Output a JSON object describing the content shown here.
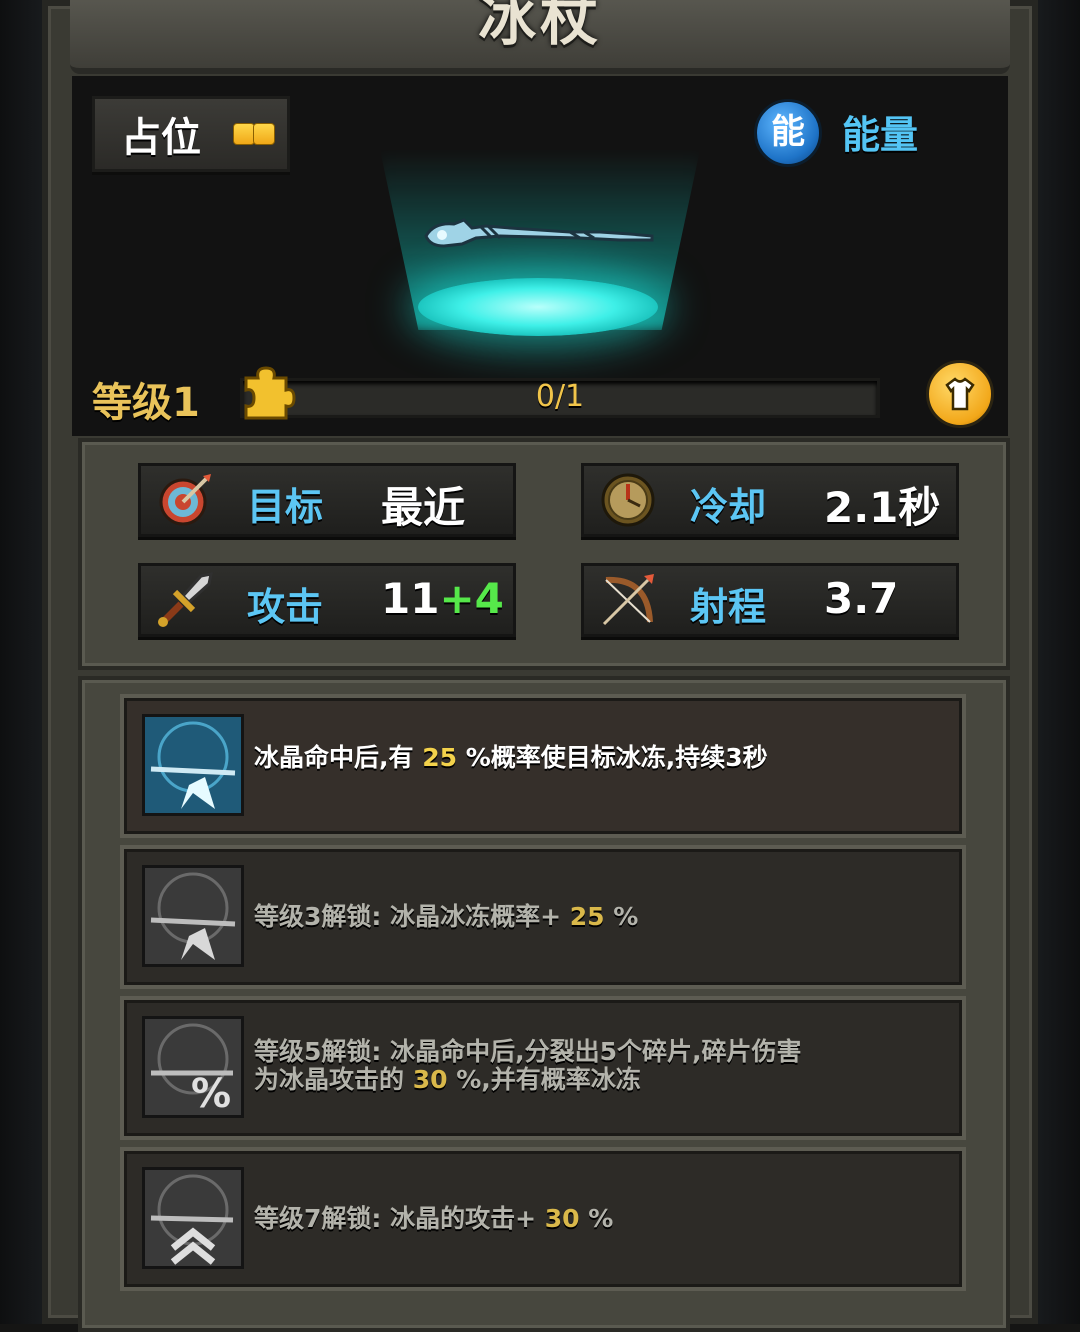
{
  "title": "冰杖",
  "slot": {
    "label": "占位"
  },
  "energy": {
    "icon_char": "能",
    "label": "能量"
  },
  "level": {
    "label": "等级1",
    "progress_text": "0/1",
    "progress": 0
  },
  "stats": {
    "target": {
      "label": "目标",
      "value": "最近"
    },
    "cooldown": {
      "label": "冷却",
      "value": "2.1秒"
    },
    "attack": {
      "label": "攻击",
      "base": "11",
      "bonus": "+4"
    },
    "range": {
      "label": "射程",
      "value": "3.7"
    }
  },
  "skills": [
    {
      "p1": "冰晶命中后,有 ",
      "v1": "25",
      "p2": " %概率使目标冰冻,持续3秒"
    },
    {
      "p1": "等级3解锁:  冰晶冰冻概率+ ",
      "v1": "25",
      "p2": " %"
    },
    {
      "p1": "等级5解锁:  冰晶命中后,分裂出5个碎片,碎片伤害",
      "l2a": "为冰晶攻击的 ",
      "v1": "30",
      "p2": " %,并有概率冰冻"
    },
    {
      "p1": "等级7解锁:  冰晶的攻击+ ",
      "v1": "30",
      "p2": " %"
    }
  ],
  "colors": {
    "accent_blue": "#5cc6f4",
    "gold": "#e9c35a",
    "bonus_green": "#56e84a",
    "glow": "#3ff0e8"
  },
  "icons": [
    "puzzle-piece-icon",
    "shirt-icon",
    "target-icon",
    "compass-icon",
    "sword-icon",
    "bow-icon",
    "ice-staff-icon"
  ]
}
